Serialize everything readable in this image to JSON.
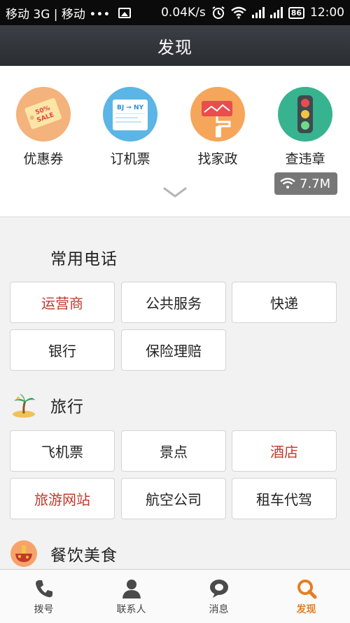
{
  "status_bar": {
    "carrier_left": "移动 3G | 移动 •••",
    "speed": "0.04K/s",
    "battery": "86",
    "time": "12:00"
  },
  "header": {
    "title": "发现"
  },
  "top_services": [
    {
      "label": "优惠券",
      "icon": "coupon-icon",
      "badge": "50% SALE"
    },
    {
      "label": "订机票",
      "icon": "flight-ticket-icon",
      "badge": "BJ ✈ NY"
    },
    {
      "label": "找家政",
      "icon": "paint-roller-icon"
    },
    {
      "label": "查违章",
      "icon": "traffic-light-icon"
    }
  ],
  "speed_badge": {
    "value": "7.7M"
  },
  "sections": {
    "phone": {
      "title": "常用电话",
      "buttons": [
        "运营商",
        "公共服务",
        "快递",
        "银行",
        "保险理赔"
      ]
    },
    "travel": {
      "title": "旅行",
      "buttons": [
        "飞机票",
        "景点",
        "酒店",
        "旅游网站",
        "航空公司",
        "租车代驾"
      ]
    },
    "food": {
      "title": "餐饮美食"
    }
  },
  "bottom_nav": [
    {
      "label": "拨号",
      "icon": "phone-icon"
    },
    {
      "label": "联系人",
      "icon": "contacts-icon"
    },
    {
      "label": "消息",
      "icon": "message-icon"
    },
    {
      "label": "发现",
      "icon": "discover-icon"
    }
  ],
  "colors": {
    "accent_red": "#c0392b",
    "active_orange": "#e67e22"
  }
}
